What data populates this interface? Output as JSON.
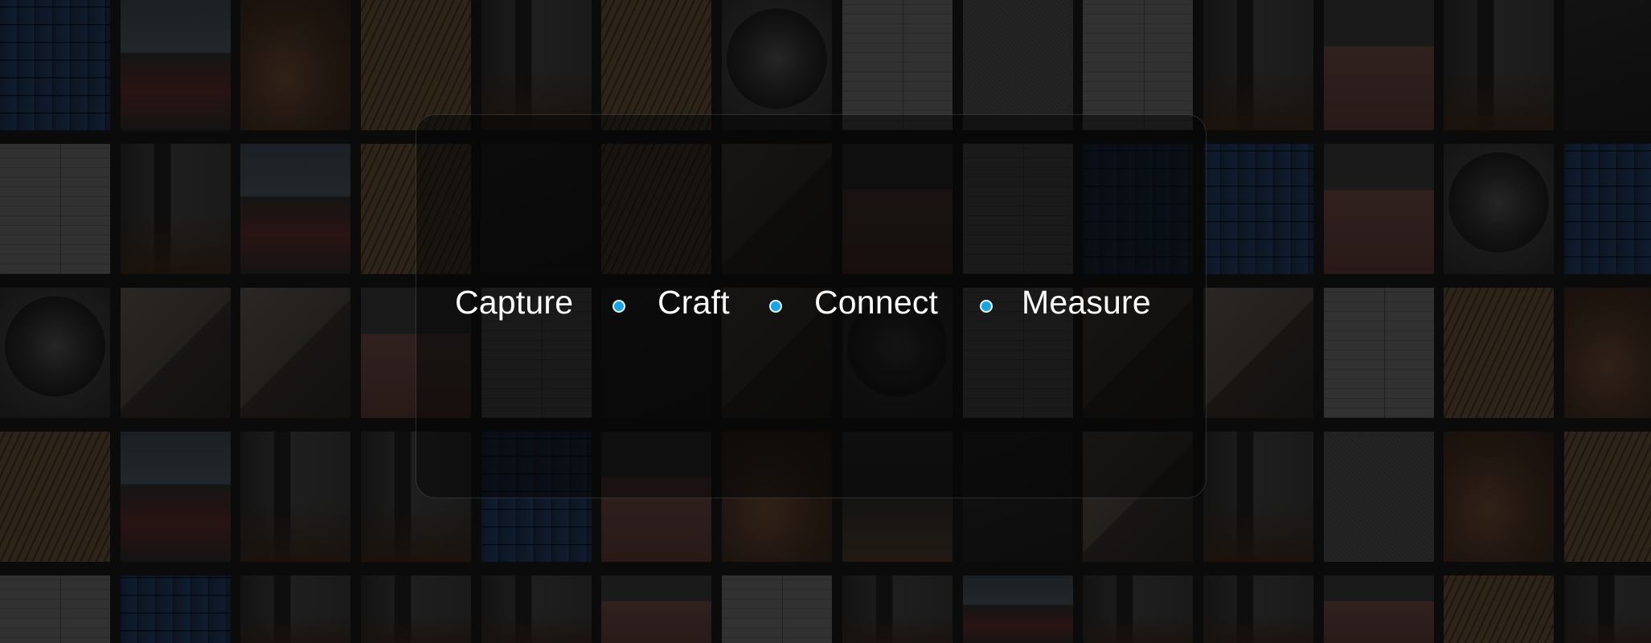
{
  "tagline": {
    "words": [
      "Capture",
      "Craft",
      "Connect",
      "Measure"
    ],
    "separator_color": "#1aa3e6",
    "text_color": "#ffffff"
  },
  "background": {
    "description_tiles": 70,
    "overlay": "dimmed photo mosaic"
  }
}
